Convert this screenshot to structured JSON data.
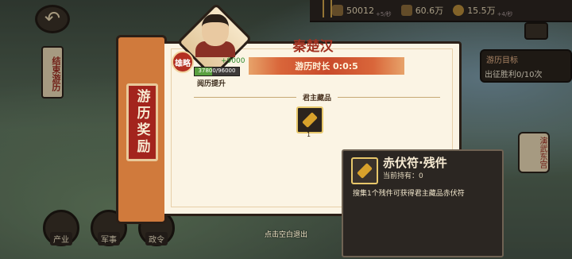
{
  "resources": [
    {
      "name": "military",
      "value": "50012",
      "sub": "+5/秒"
    },
    {
      "name": "grain",
      "value": "60.6万",
      "sub": ""
    },
    {
      "name": "coins",
      "value": "15.5万",
      "sub": "+4/秒"
    }
  ],
  "left_banner": "结束游历",
  "right_goal": {
    "title": "游历目标",
    "text": "出征胜利0/10次"
  },
  "right_side_button": "演武东宫",
  "bottom_nav": [
    {
      "label": "产业"
    },
    {
      "label": "军事"
    },
    {
      "label": "政令"
    }
  ],
  "panel": {
    "tab": "游历奖励",
    "title": "秦楚汉",
    "duration": "游历时长  0:0:5",
    "section": "君主藏品",
    "item_count": "1"
  },
  "general": {
    "badge": "雄略",
    "exp_gain": "+9000",
    "exp_text": "37800/96000",
    "exp_progress": 0.39375,
    "caption": "阅历提升"
  },
  "tooltip": {
    "name": "赤伏符·残件",
    "owned": "当前持有：0",
    "desc": "搜集1个残件可获得君主藏品赤伏符"
  },
  "footer": "点击空白退出"
}
